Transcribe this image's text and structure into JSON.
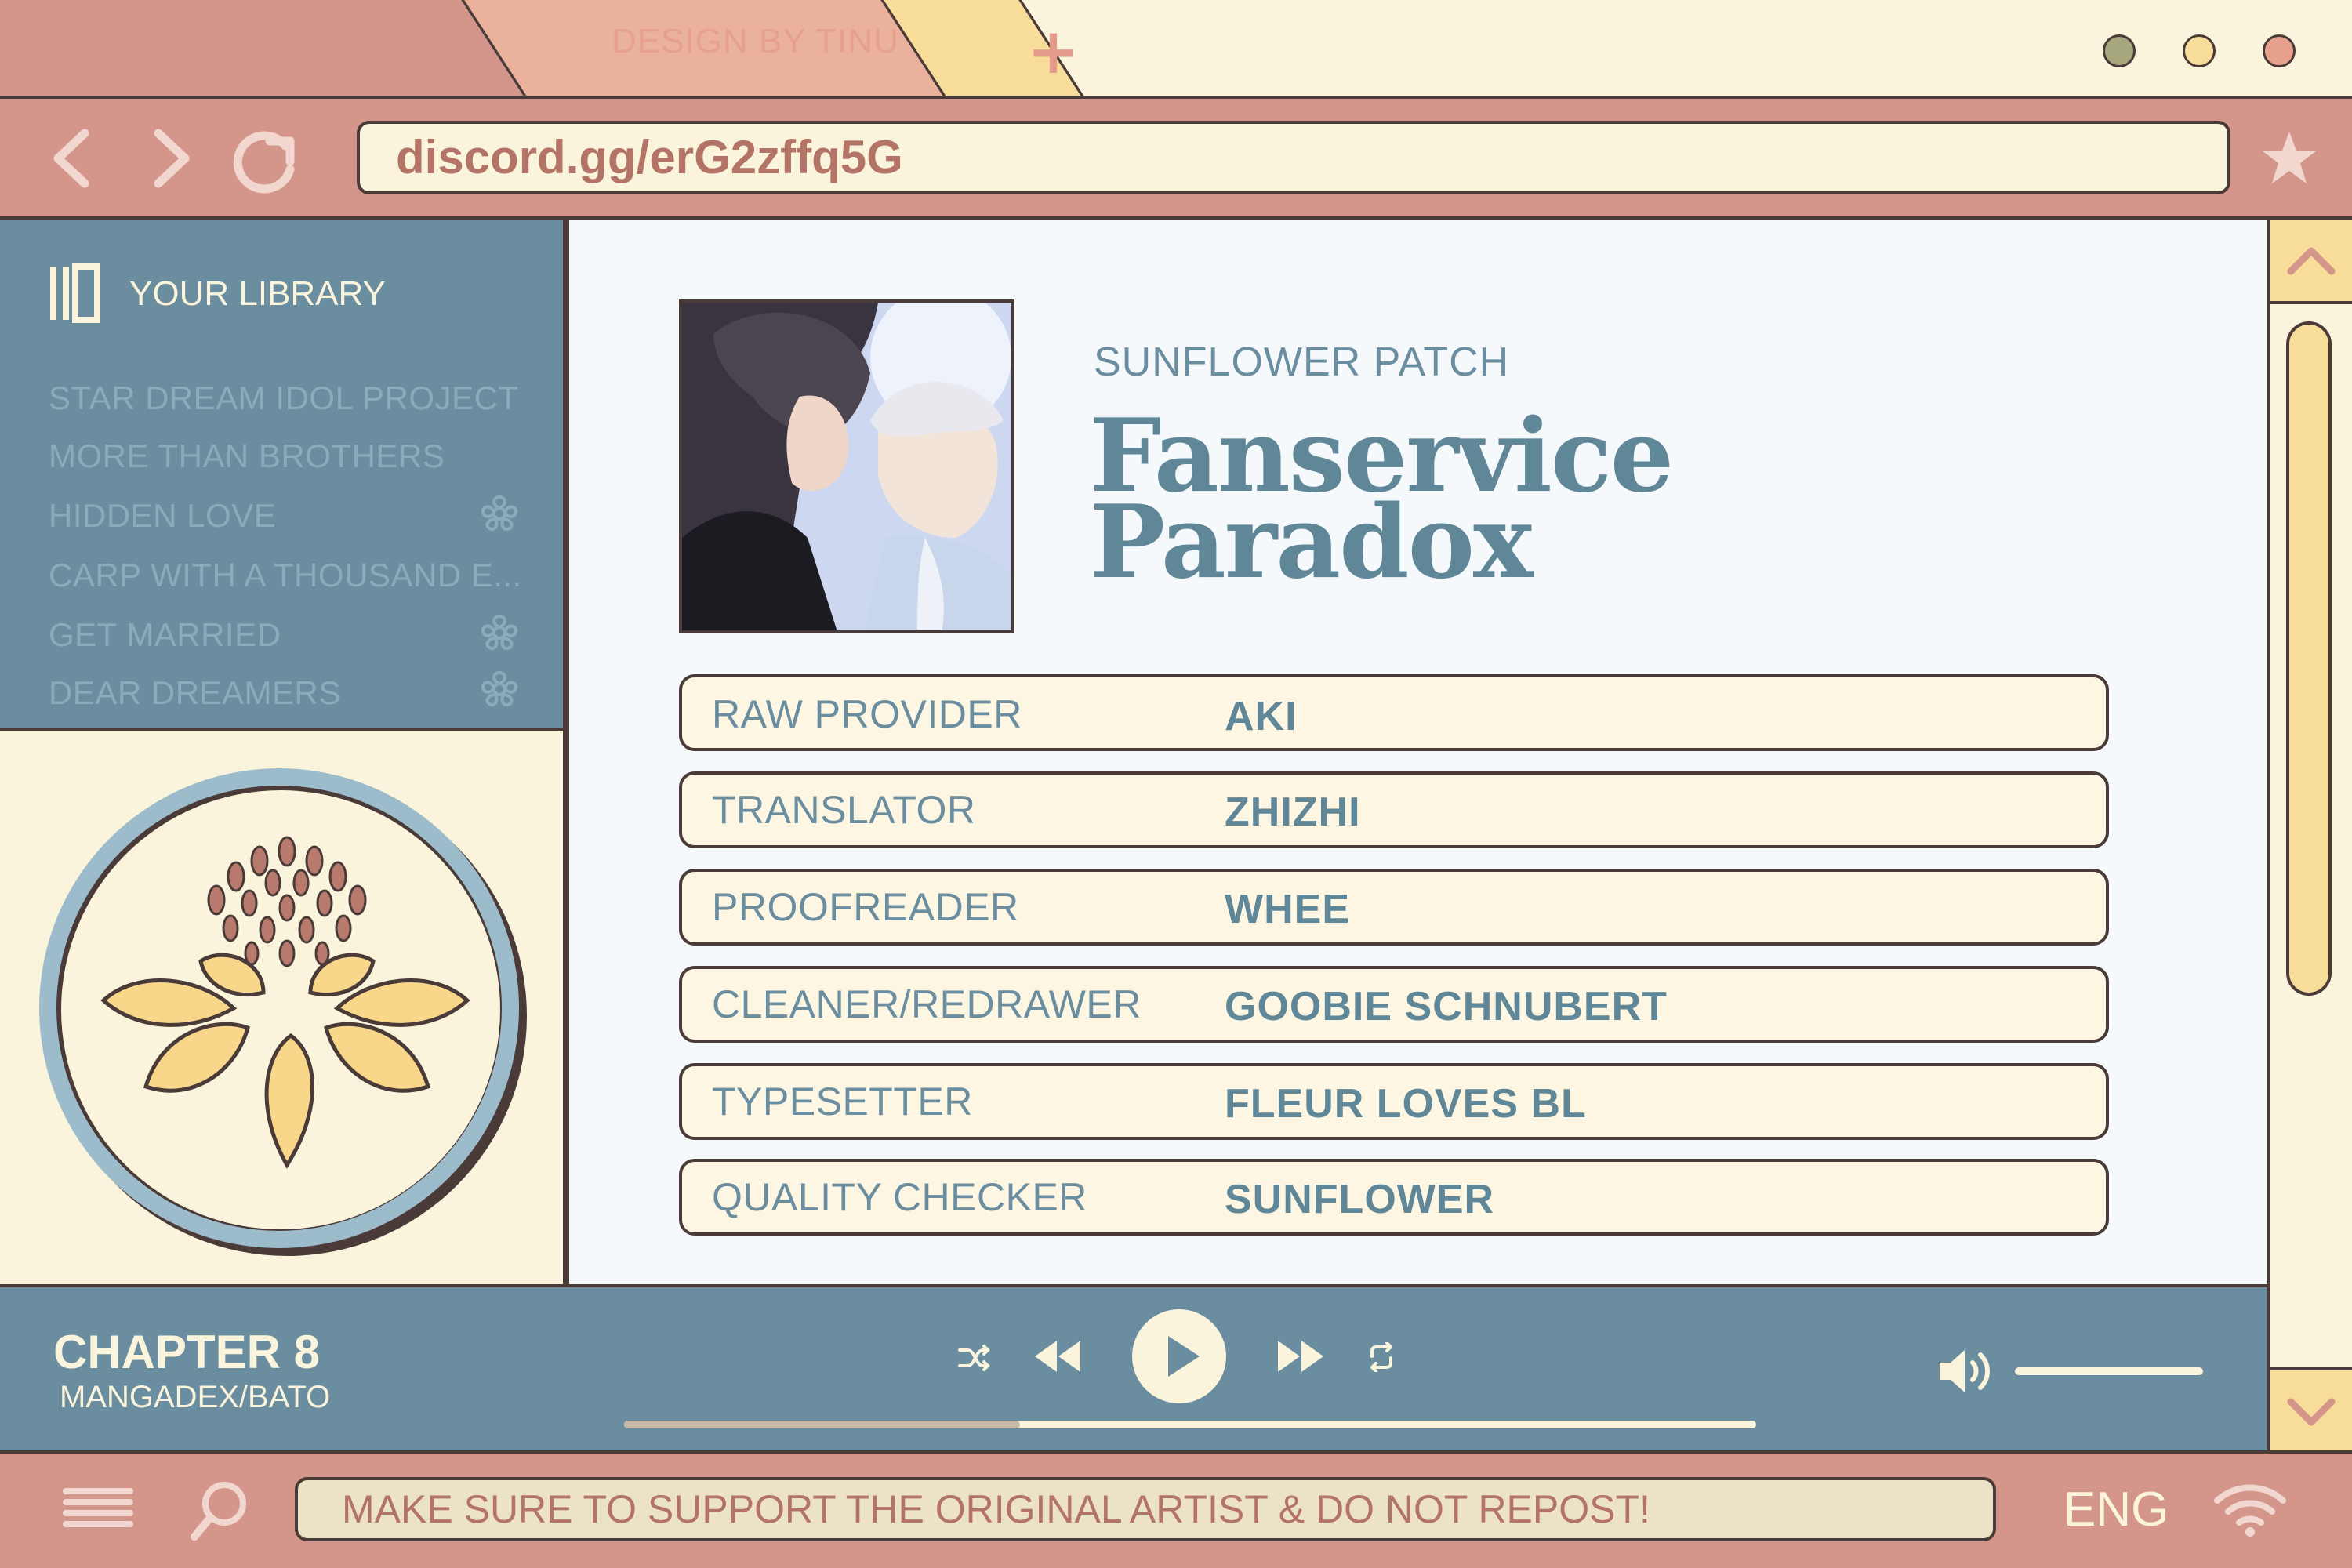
{
  "tabs": {
    "design_label": "DESIGN BY TINU"
  },
  "colors": {
    "rose": "#d4968a",
    "cream": "#faf4dc",
    "teal": "#6a8ea0",
    "yellow": "#f8dd9a",
    "outline": "#4a3a38",
    "dot_green": "#a6a77c",
    "dot_yellow": "#f8dd9a",
    "dot_red": "#e6a08c"
  },
  "address_bar": {
    "url": "discord.gg/erG2zffq5G"
  },
  "sidebar": {
    "title": "YOUR LIBRARY",
    "items": [
      {
        "label": "STAR DREAM IDOL PROJECT",
        "flagged": false
      },
      {
        "label": "MORE THAN BROTHERS",
        "flagged": false
      },
      {
        "label": "HIDDEN LOVE",
        "flagged": true
      },
      {
        "label": "CARP WITH A THOUSAND E...",
        "flagged": false
      },
      {
        "label": "GET MARRIED",
        "flagged": true
      },
      {
        "label": "DEAR DREAMERS",
        "flagged": true
      }
    ]
  },
  "main": {
    "group": "SUNFLOWER PATCH",
    "title_line1": "Fanservice",
    "title_line2": "Paradox",
    "credits": [
      {
        "role": "RAW PROVIDER",
        "name": "AKI"
      },
      {
        "role": "TRANSLATOR",
        "name": "ZHIZHI"
      },
      {
        "role": "PROOFREADER",
        "name": "WHEE"
      },
      {
        "role": "CLEANER/REDRAWER",
        "name": "GOOBIE SCHNUBERT"
      },
      {
        "role": "TYPESETTER",
        "name": "FLEUR LOVES BL"
      },
      {
        "role": "QUALITY CHECKER",
        "name": "SUNFLOWER"
      }
    ]
  },
  "player": {
    "chapter": "CHAPTER 8",
    "source": "MANGADEX/BATO",
    "progress": 0.35,
    "volume": 1.0
  },
  "footer": {
    "message": "MAKE SURE TO SUPPORT THE ORIGINAL ARTIST & DO NOT REPOST!",
    "language": "ENG"
  }
}
